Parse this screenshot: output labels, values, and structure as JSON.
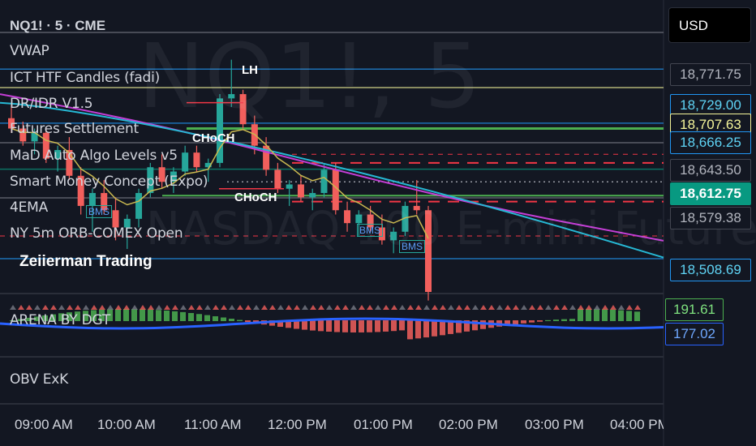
{
  "header": {
    "symbol_title": "NQ1! · 5 · CME",
    "currency": "USD"
  },
  "watermark": {
    "symbol": "NQ1!, 5",
    "subtitle": "NASDAQ 100 E-mini Futures"
  },
  "indicators": [
    "VWAP",
    "ICT HTF Candles (fadi)",
    "DR/IDR V1.5",
    "Futures Settlement",
    "MaD Auto Algo Levels v5",
    "Smart Money Concept (Expo)",
    "4EMA",
    "NY 5m ORB-COMEX Open"
  ],
  "annotations": {
    "lh": "LH",
    "choch_1": "CHoCH",
    "choch_2": "CHoCH",
    "bms_1": "BMS",
    "bms_2": "BMS",
    "bms_3": "BMS",
    "author": "Zeiierman Trading"
  },
  "price_labels": [
    {
      "value": "18,771.75",
      "bg": "#131722",
      "fg": "#b2b5be",
      "border": "#434651"
    },
    {
      "value": "18,729.00",
      "bg": "#131722",
      "fg": "#5fd4f5",
      "border": "#2196f3"
    },
    {
      "value": "18,707.63",
      "bg": "#131722",
      "fg": "#f5f59a",
      "border": "#f5f59a"
    },
    {
      "value": "18,666.25",
      "bg": "#131722",
      "fg": "#5fd4f5",
      "border": "#2196f3"
    },
    {
      "value": "18,643.50",
      "bg": "#131722",
      "fg": "#b2b5be",
      "border": "#434651"
    },
    {
      "value": "18,612.75",
      "bg": "#089981",
      "fg": "#ffffff",
      "border": "#089981"
    },
    {
      "value": "18,579.38",
      "bg": "#131722",
      "fg": "#b2b5be",
      "border": "#434651"
    },
    {
      "value": "18,508.69",
      "bg": "#131722",
      "fg": "#5fd4f5",
      "border": "#2196f3"
    }
  ],
  "sub_panes": {
    "arena": {
      "label": "ARENA BY DGT",
      "values": [
        "191.61",
        "177.02"
      ]
    },
    "obv": {
      "label": "OBV ExK"
    }
  },
  "chart_data": {
    "type": "candlestick",
    "title": "NQ1! · 5 · CME",
    "x_ticks": [
      "09:00 AM",
      "10:00 AM",
      "11:00 AM",
      "12:00 PM",
      "01:00 PM",
      "02:00 PM",
      "03:00 PM",
      "04:00 PM"
    ],
    "price_axis_labels": [
      18771.75,
      18729.0,
      18707.63,
      18666.25,
      18643.5,
      18612.75,
      18579.38,
      18508.69
    ],
    "ylim": [
      18470,
      18800
    ],
    "last_price": 18612.75,
    "candles": [
      [
        18672,
        18690,
        18655,
        18660
      ],
      [
        18660,
        18668,
        18640,
        18645
      ],
      [
        18645,
        18660,
        18630,
        18655
      ],
      [
        18655,
        18662,
        18620,
        18625
      ],
      [
        18625,
        18640,
        18610,
        18635
      ],
      [
        18635,
        18650,
        18600,
        18605
      ],
      [
        18605,
        18615,
        18560,
        18570
      ],
      [
        18570,
        18590,
        18540,
        18585
      ],
      [
        18585,
        18600,
        18560,
        18565
      ],
      [
        18565,
        18580,
        18530,
        18545
      ],
      [
        18545,
        18560,
        18520,
        18555
      ],
      [
        18555,
        18590,
        18545,
        18585
      ],
      [
        18585,
        18620,
        18580,
        18615
      ],
      [
        18615,
        18630,
        18590,
        18598
      ],
      [
        18598,
        18615,
        18585,
        18610
      ],
      [
        18610,
        18640,
        18605,
        18632
      ],
      [
        18632,
        18640,
        18610,
        18615
      ],
      [
        18615,
        18625,
        18598,
        18620
      ],
      [
        18620,
        18700,
        18615,
        18695
      ],
      [
        18695,
        18740,
        18685,
        18700
      ],
      [
        18700,
        18705,
        18660,
        18665
      ],
      [
        18665,
        18675,
        18630,
        18640
      ],
      [
        18640,
        18650,
        18605,
        18612
      ],
      [
        18612,
        18620,
        18585,
        18590
      ],
      [
        18590,
        18600,
        18570,
        18595
      ],
      [
        18595,
        18605,
        18575,
        18580
      ],
      [
        18580,
        18590,
        18565,
        18585
      ],
      [
        18585,
        18618,
        18580,
        18612
      ],
      [
        18612,
        18620,
        18560,
        18565
      ],
      [
        18565,
        18575,
        18540,
        18550
      ],
      [
        18550,
        18565,
        18535,
        18560
      ],
      [
        18560,
        18570,
        18540,
        18545
      ],
      [
        18545,
        18560,
        18525,
        18530
      ],
      [
        18530,
        18545,
        18515,
        18540
      ],
      [
        18540,
        18575,
        18535,
        18570
      ],
      [
        18570,
        18600,
        18560,
        18565
      ],
      [
        18565,
        18570,
        18460,
        18470
      ]
    ],
    "arena_values": [
      191.61,
      177.02
    ]
  }
}
